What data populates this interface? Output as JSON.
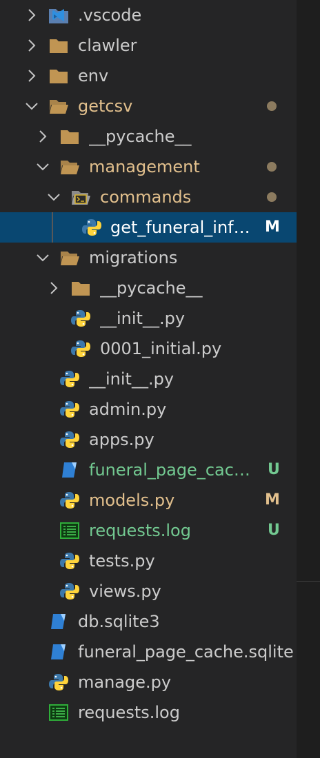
{
  "colors": {
    "background": "#252526",
    "selected_row": "#094771",
    "modified": "#e2c08d",
    "untracked": "#73c991",
    "folder": "#c09553",
    "python_blue": "#3c78aa",
    "python_yellow": "#ffd43b"
  },
  "explorer": {
    "items": [
      {
        "label": ".vscode",
        "icon": "vscode-folder-icon",
        "state": "collapsed"
      },
      {
        "label": "clawler",
        "icon": "folder-icon",
        "state": "collapsed"
      },
      {
        "label": "env",
        "icon": "folder-icon",
        "state": "collapsed"
      },
      {
        "label": "getcsv",
        "icon": "folder-open-icon",
        "state": "expanded"
      },
      {
        "label": "__pycache__",
        "icon": "folder-icon",
        "state": "collapsed"
      },
      {
        "label": "management",
        "icon": "folder-open-icon",
        "state": "expanded"
      },
      {
        "label": "commands",
        "icon": "commands-folder-icon",
        "state": "expanded"
      },
      {
        "label": "get_funeral_info.py",
        "display": "get_funeral_info…",
        "icon": "python-icon",
        "badge": "M",
        "selected": true
      },
      {
        "label": "migrations",
        "icon": "folder-open-icon",
        "state": "expanded"
      },
      {
        "label": "__pycache__",
        "icon": "folder-icon",
        "state": "collapsed"
      },
      {
        "label": "__init__.py",
        "icon": "python-icon"
      },
      {
        "label": "0001_initial.py",
        "icon": "python-icon"
      },
      {
        "label": "__init__.py",
        "icon": "python-icon"
      },
      {
        "label": "admin.py",
        "icon": "python-icon"
      },
      {
        "label": "apps.py",
        "icon": "python-icon"
      },
      {
        "label": "funeral_page_cache.sqlite",
        "display": "funeral_page_cach…",
        "icon": "database-icon",
        "badge": "U"
      },
      {
        "label": "models.py",
        "icon": "python-icon",
        "badge": "M"
      },
      {
        "label": "requests.log",
        "icon": "log-file-icon",
        "badge": "U"
      },
      {
        "label": "tests.py",
        "icon": "python-icon"
      },
      {
        "label": "views.py",
        "icon": "python-icon"
      },
      {
        "label": "db.sqlite3",
        "icon": "database-icon"
      },
      {
        "label": "funeral_page_cache.sqlite",
        "icon": "database-icon"
      },
      {
        "label": "manage.py",
        "icon": "python-icon"
      },
      {
        "label": "requests.log",
        "icon": "log-file-icon"
      }
    ]
  }
}
